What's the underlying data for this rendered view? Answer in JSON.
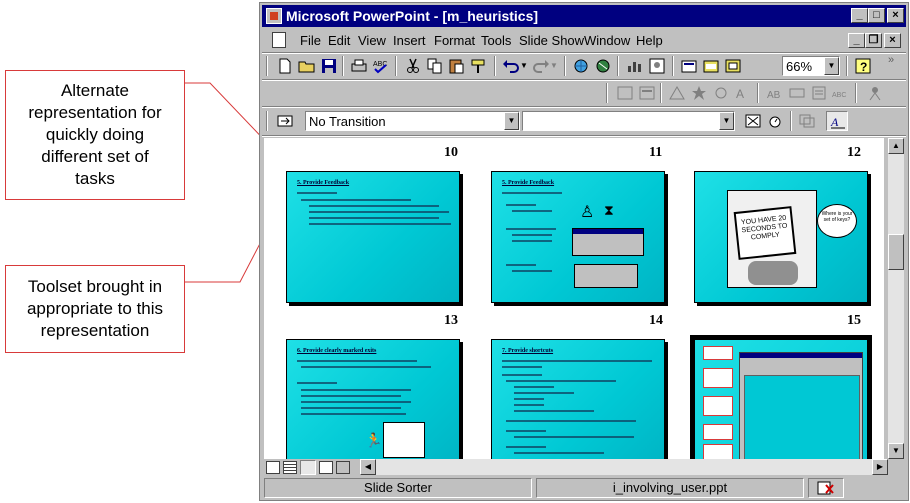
{
  "callouts": [
    {
      "text": "Alternate\nrepresentation for\nquickly doing\ndifferent set of\ntasks"
    },
    {
      "text": "Toolset brought in\nappropriate to this\nrepresentation"
    }
  ],
  "window": {
    "title": "Microsoft PowerPoint - [m_heuristics]",
    "caption_buttons": [
      "minimize",
      "maximize",
      "close"
    ],
    "doc_buttons": [
      "minimize",
      "restore",
      "close"
    ]
  },
  "menu": {
    "items": [
      "File",
      "Edit",
      "View",
      "Insert",
      "Format",
      "Tools",
      "Slide Show",
      "Window",
      "Help"
    ]
  },
  "toolbar": {
    "zoom": "66%",
    "transition": "No Transition",
    "transition_text": ""
  },
  "slides": [
    {
      "number": "10",
      "title": "5. Provide Feedback"
    },
    {
      "number": "11",
      "title": "5. Provide Feedback"
    },
    {
      "number": "12",
      "title": ""
    },
    {
      "number": "13",
      "title": "6. Provide clearly marked exits"
    },
    {
      "number": "14",
      "title": "7. Provide shortcuts"
    },
    {
      "number": "15",
      "title": ""
    }
  ],
  "cartoon": {
    "sign": "YOU HAVE 20 SECONDS TO COMPLY",
    "bubble": "Where is your set of keys?"
  },
  "status": {
    "view": "Slide Sorter",
    "template": "i_involving_user.ppt"
  },
  "colors": {
    "titlebar": "#000080",
    "chrome": "#c0c0c0",
    "slide_bg": "#00c8d4",
    "callout_border": "#d83a3a"
  }
}
